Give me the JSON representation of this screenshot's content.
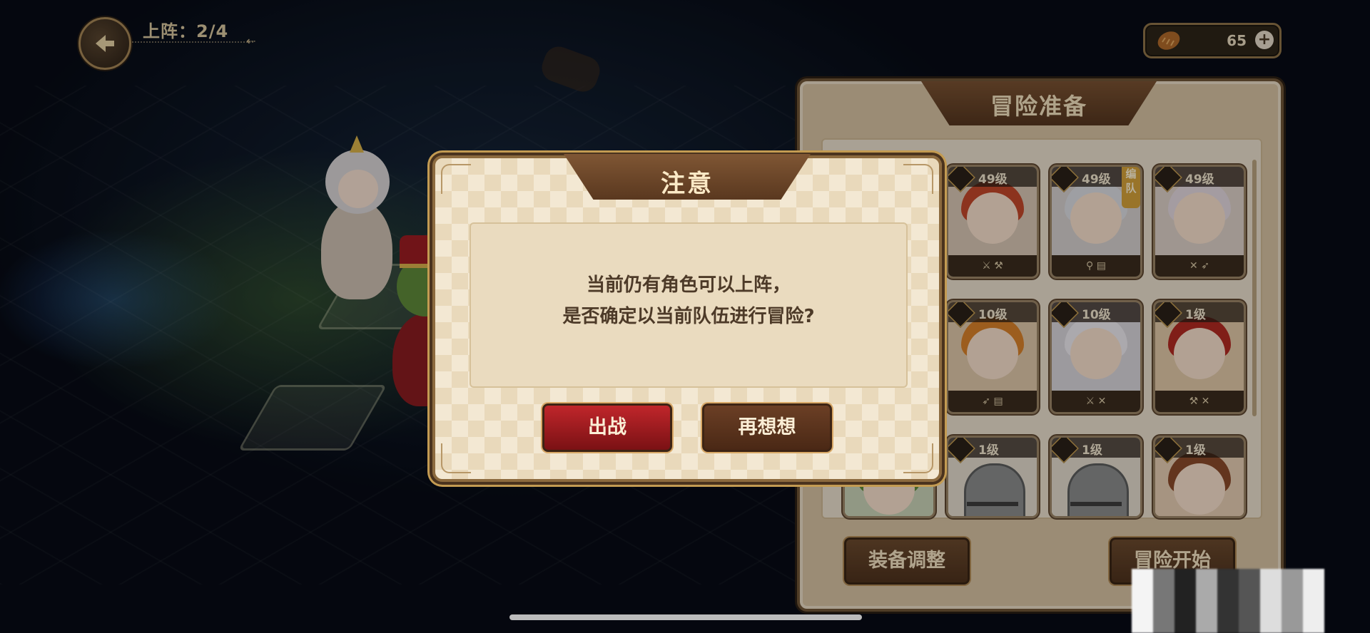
{
  "hud": {
    "deploy_label": "上阵：2/4",
    "currency_value": "65",
    "plus_label": "+"
  },
  "panel": {
    "title": "冒险准备",
    "cards": [
      {
        "level": "49级",
        "team_label": ""
      },
      {
        "level": "49级",
        "team_label": "编队"
      },
      {
        "level": "49级",
        "team_label": ""
      },
      {
        "level": "10级",
        "team_label": ""
      },
      {
        "level": "10级",
        "team_label": ""
      },
      {
        "level": "1级",
        "team_label": ""
      },
      {
        "level": "1级",
        "team_label": ""
      },
      {
        "level": "1级",
        "team_label": ""
      },
      {
        "level": "1级",
        "team_label": ""
      }
    ],
    "equip_button": "装备调整",
    "start_button": "冒险开始"
  },
  "dialog": {
    "title": "注意",
    "message_line1": "当前仍有角色可以上阵，",
    "message_line2": "是否确定以当前队伍进行冒险?",
    "confirm_button": "出战",
    "cancel_button": "再想想"
  },
  "colors": {
    "dialog_bg": "#f3e8d3",
    "header_brown": "#6b4428",
    "confirm_red": "#a61c20",
    "cancel_brown": "#5a331d",
    "gold_border": "#c39b52"
  }
}
